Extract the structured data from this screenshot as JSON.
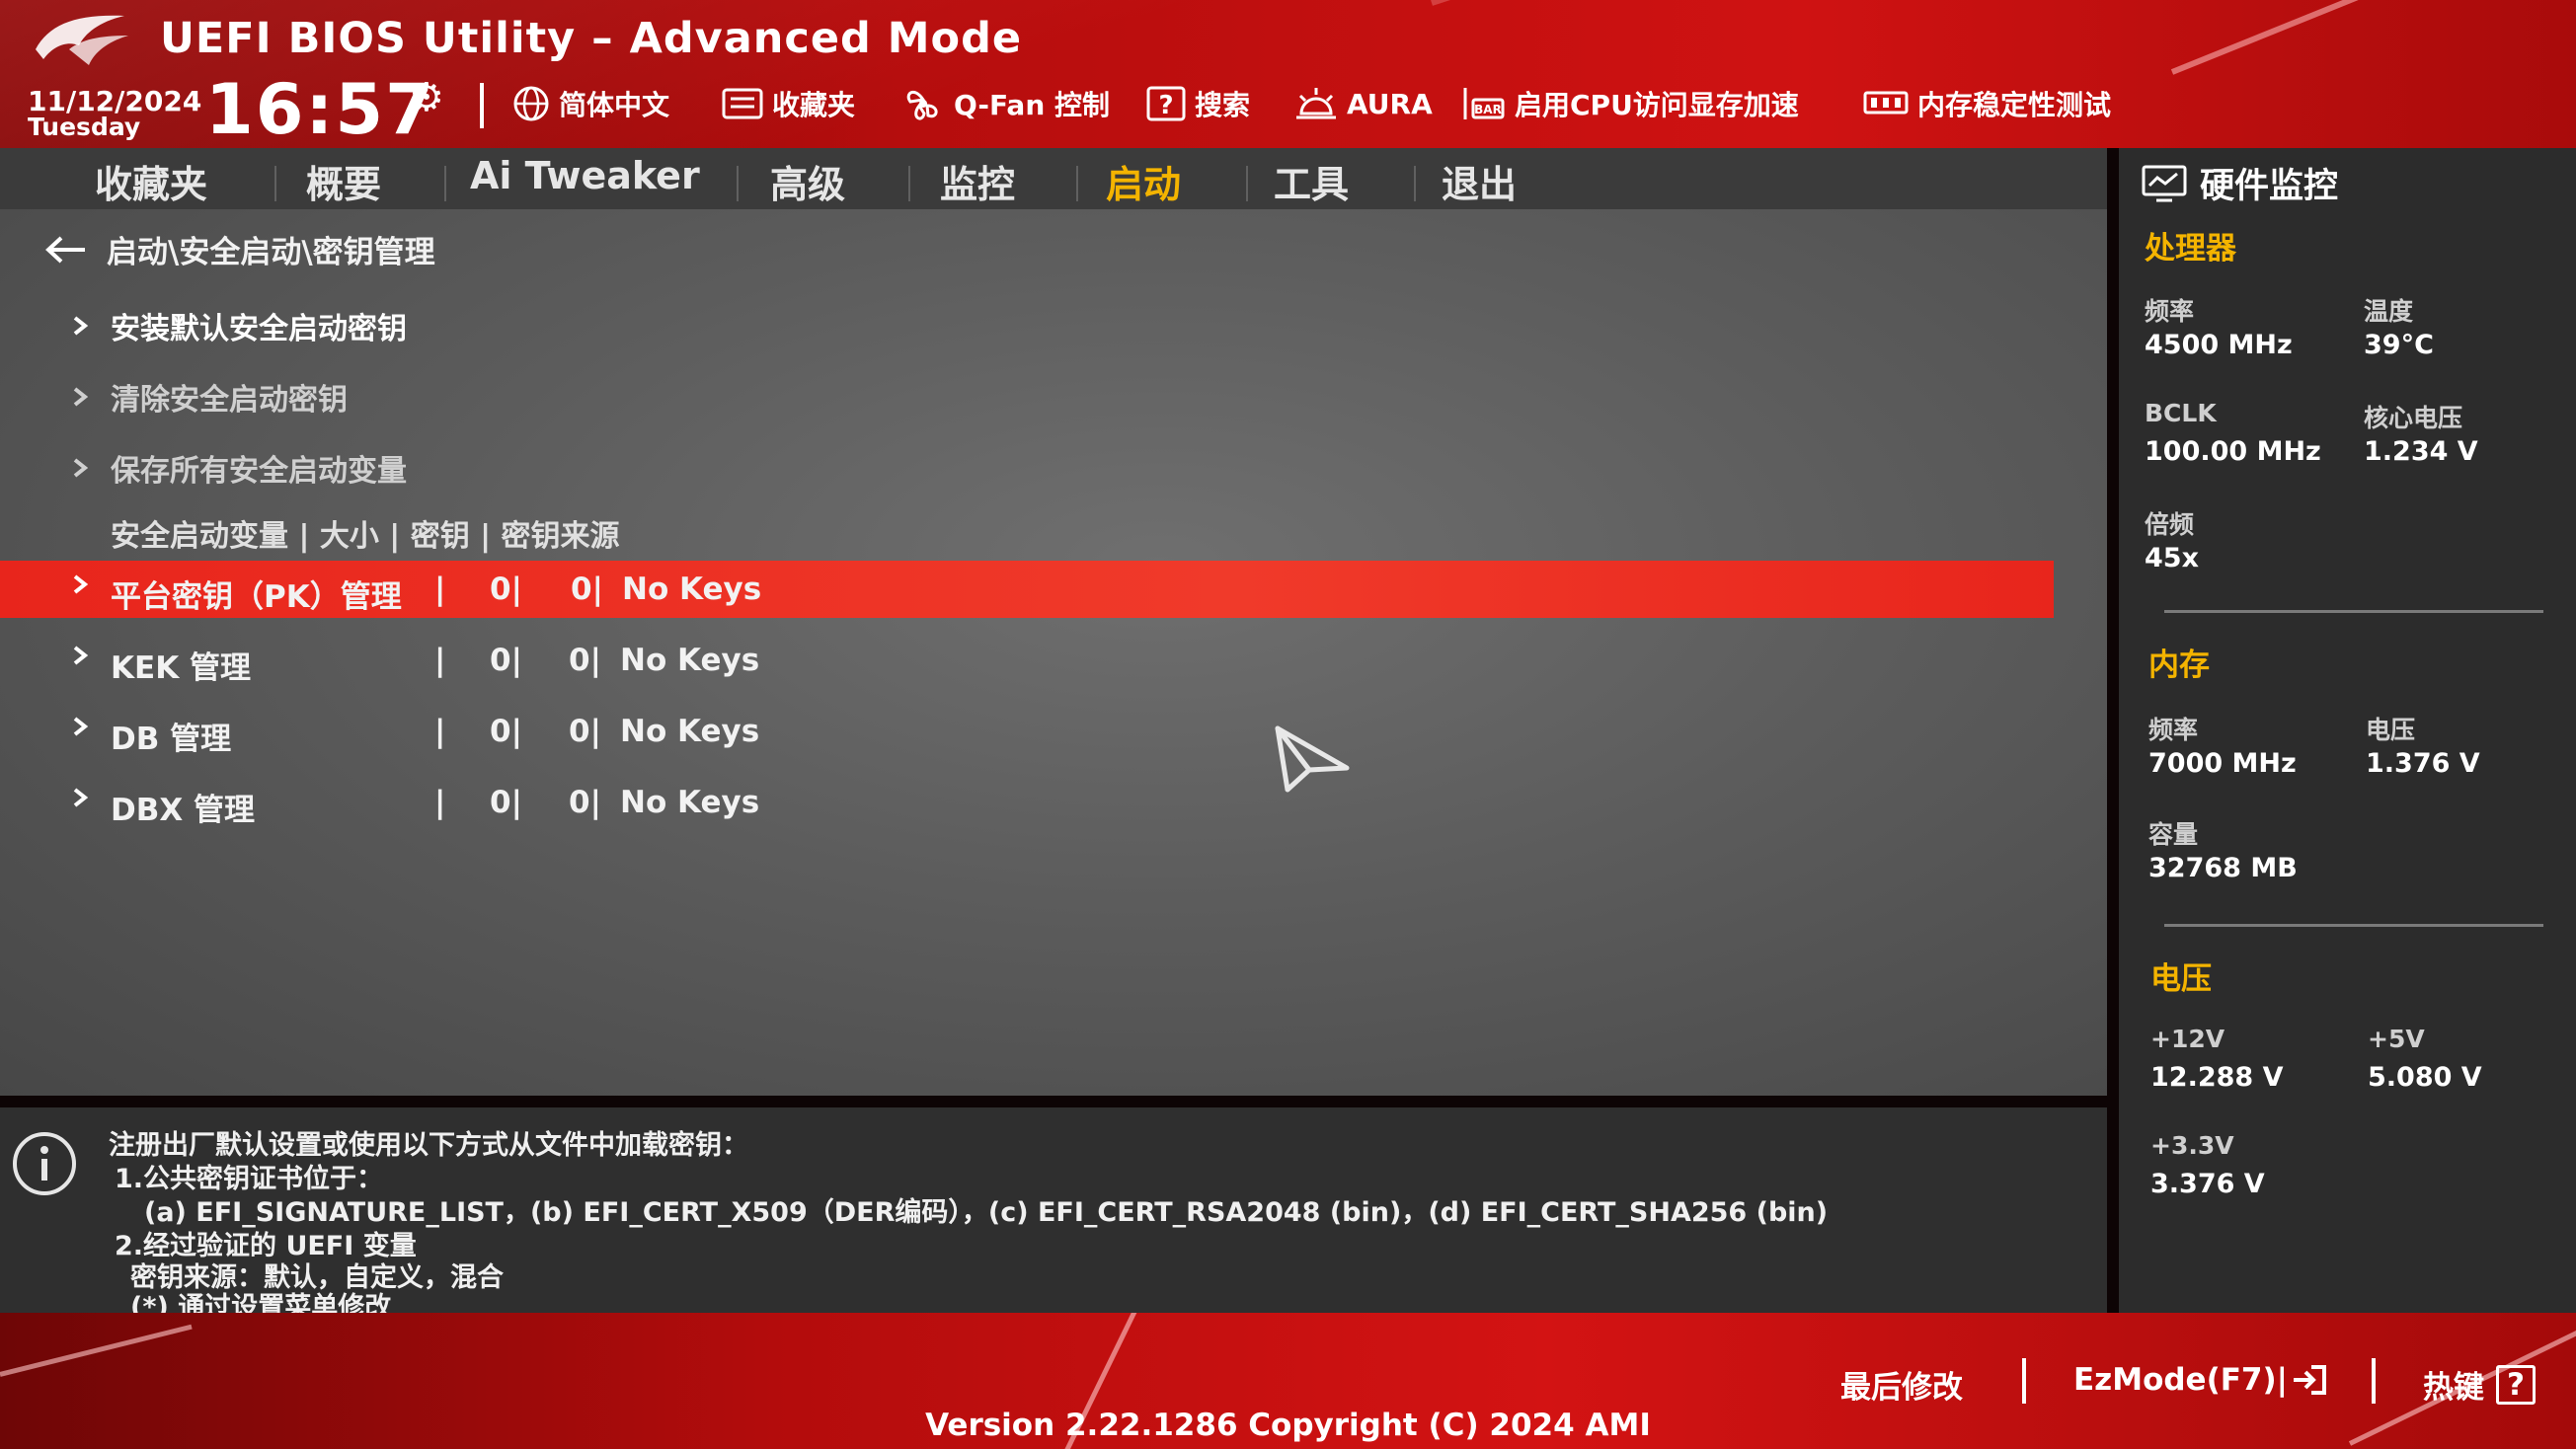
{
  "app": {
    "title": "UEFI BIOS Utility – Advanced Mode"
  },
  "header": {
    "date": "11/12/2024",
    "weekday": "Tuesday",
    "time": "16:57",
    "toolbar": [
      {
        "label": "简体中文",
        "icon": "globe-icon"
      },
      {
        "label": "收藏夹",
        "icon": "favorites-icon"
      },
      {
        "label": "Q-Fan 控制",
        "icon": "fan-icon"
      },
      {
        "label": "搜索",
        "icon": "help-search-icon"
      },
      {
        "label": "AURA",
        "icon": "aura-icon"
      },
      {
        "label": "启用CPU访问显存加速",
        "icon": "rebar-icon"
      },
      {
        "label": "内存稳定性测试",
        "icon": "memory-icon"
      }
    ]
  },
  "tabs": [
    "收藏夹",
    "概要",
    "Ai Tweaker",
    "高级",
    "监控",
    "启动",
    "工具",
    "退出"
  ],
  "active_tab": "启动",
  "breadcrumb": "启动\\安全启动\\密钥管理",
  "menu": {
    "items": [
      {
        "label": "安装默认安全启动密钥"
      },
      {
        "label": "清除安全启动密钥"
      },
      {
        "label": "保存所有安全启动变量"
      }
    ],
    "column_header": "安全启动变量 | 大小 | 密钥 | 密钥来源",
    "rows": [
      {
        "name": "平台密钥（PK）管理",
        "sep": "|",
        "size": "0|",
        "keys": "0|",
        "source": "No Keys",
        "selected": true
      },
      {
        "name": "KEK 管理",
        "sep": "|",
        "size": "0|",
        "keys": "0|",
        "source": "No Keys",
        "selected": false
      },
      {
        "name": "DB 管理",
        "sep": "|",
        "size": "0|",
        "keys": "0|",
        "source": "No Keys",
        "selected": false
      },
      {
        "name": "DBX 管理",
        "sep": "|",
        "size": "0|",
        "keys": "0|",
        "source": "No Keys",
        "selected": false
      }
    ]
  },
  "help": {
    "lines": [
      "注册出厂默认设置或使用以下方式从文件中加载密钥：",
      "1.公共密钥证书位于：",
      "(a) EFI_SIGNATURE_LIST，(b) EFI_CERT_X509（DER编码），(c) EFI_CERT_RSA2048 (bin)，(d) EFI_CERT_SHA256 (bin)",
      "2.经过验证的 UEFI 变量",
      "密钥来源：默认，自定义，混合",
      "(*) 通过设置菜单修改"
    ]
  },
  "hardware_monitor": {
    "title": "硬件监控",
    "cpu": {
      "title": "处理器",
      "freq_label": "频率",
      "freq": "4500 MHz",
      "temp_label": "温度",
      "temp": "39°C",
      "bclk_label": "BCLK",
      "bclk": "100.00 MHz",
      "vcore_label": "核心电压",
      "vcore": "1.234 V",
      "ratio_label": "倍频",
      "ratio": "45x"
    },
    "memory": {
      "title": "内存",
      "freq_label": "频率",
      "freq": "7000 MHz",
      "volt_label": "电压",
      "volt": "1.376 V",
      "cap_label": "容量",
      "cap": "32768 MB"
    },
    "voltage": {
      "title": "电压",
      "v12_label": "+12V",
      "v12": "12.288 V",
      "v5_label": "+5V",
      "v5": "5.080 V",
      "v33_label": "+3.3V",
      "v33": "3.376 V"
    }
  },
  "footer": {
    "last_modified": "最后修改",
    "ezmode": "EzMode(F7)|",
    "hotkeys": "热键",
    "hotkey_symbol": "?",
    "version": "Version 2.22.1286 Copyright (C) 2024 AMI"
  },
  "colors": {
    "accent_red": "#e8251c",
    "accent_yellow": "#f4b400",
    "panel_gray": "#2c2c2c"
  }
}
